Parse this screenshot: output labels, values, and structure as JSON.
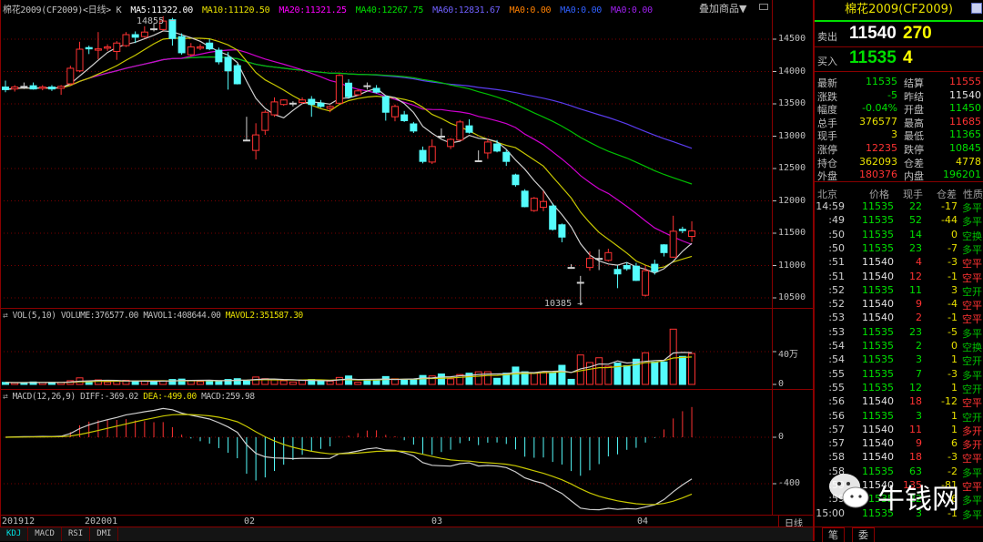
{
  "header": {
    "title": "棉花2009(CF2009)<日线> K",
    "ma_labels": [
      {
        "text": "MA5:11322.00",
        "color": "#ffffff"
      },
      {
        "text": "MA10:11120.50",
        "color": "#e8e000"
      },
      {
        "text": "MA20:11321.25",
        "color": "#ff00ff"
      },
      {
        "text": "MA40:12267.75",
        "color": "#00e000"
      },
      {
        "text": "MA60:12831.67",
        "color": "#7060ff"
      },
      {
        "text": "MA0:0.00",
        "color": "#ff8000"
      },
      {
        "text": "MA0:0.00",
        "color": "#3060ff"
      },
      {
        "text": "MA0:0.00",
        "color": "#a020f0"
      }
    ],
    "overlay_label": "叠加商品▼"
  },
  "volume_header": {
    "title": "VOL(5,10)",
    "volume": "VOLUME:376577.00",
    "mavol1": "MAVOL1:408644.00",
    "mavol2": "MAVOL2:351587.30"
  },
  "macd_header": {
    "title": "MACD(12,26,9)",
    "diff": "DIFF:-369.02",
    "dea": "DEA:-499.00",
    "macd": "MACD:259.98"
  },
  "chart_data": [
    {
      "type": "candlestick",
      "price_axis": {
        "ticks": [
          "14500",
          "14000",
          "13500",
          "13000",
          "12500",
          "12000",
          "11500",
          "11000",
          "10500"
        ],
        "range": [
          10500,
          14500
        ]
      },
      "volume_axis": {
        "ticks": [
          "40万",
          "0"
        ],
        "unit": "万"
      },
      "macd_axis": {
        "ticks": [
          "0",
          "-400"
        ]
      },
      "x_labels": [
        "201912",
        "202001",
        "02",
        "03",
        "04"
      ],
      "period_label": "日线",
      "annotations": {
        "high": "14855",
        "low": "10385"
      },
      "ma_periods": [
        5,
        10,
        20,
        40,
        60
      ],
      "colors": {
        "up": "#ff3232",
        "down": "#54fcfc",
        "ma5": "#d0d0d0",
        "ma10": "#c8c800",
        "ma20": "#d000d0",
        "ma40": "#00c000",
        "ma60": "#5a3cf0"
      },
      "ohlc": [
        [
          13760,
          13860,
          13680,
          13720
        ],
        [
          13730,
          13790,
          13690,
          13760
        ],
        [
          13770,
          13830,
          13730,
          13760
        ],
        [
          13780,
          13830,
          13720,
          13730
        ],
        [
          13740,
          13790,
          13710,
          13760
        ],
        [
          13760,
          13790,
          13700,
          13730
        ],
        [
          13740,
          13790,
          13640,
          13770
        ],
        [
          13810,
          14090,
          13790,
          14050
        ],
        [
          14010,
          14460,
          13990,
          14345
        ],
        [
          14370,
          14400,
          14270,
          14350
        ],
        [
          14330,
          14610,
          14190,
          14350
        ],
        [
          14360,
          14420,
          14320,
          14380
        ],
        [
          14310,
          14470,
          14180,
          14440
        ],
        [
          14400,
          14610,
          14380,
          14570
        ],
        [
          14570,
          14620,
          14440,
          14530
        ],
        [
          14540,
          14700,
          14520,
          14610
        ],
        [
          14660,
          14740,
          14620,
          14650
        ],
        [
          14650,
          14855,
          14630,
          14780
        ],
        [
          14800,
          14830,
          14400,
          14510
        ],
        [
          14540,
          14590,
          14260,
          14290
        ],
        [
          14260,
          14440,
          14230,
          14380
        ],
        [
          14360,
          14420,
          14330,
          14380
        ],
        [
          14440,
          14500,
          14330,
          14350
        ],
        [
          14330,
          14370,
          14110,
          14150
        ],
        [
          14220,
          14300,
          13720,
          14010
        ],
        [
          14090,
          14120,
          13800,
          13810
        ],
        [
          12940,
          13300,
          12930,
          12940
        ],
        [
          12780,
          13200,
          12640,
          13020
        ],
        [
          13090,
          13400,
          13020,
          13370
        ],
        [
          13330,
          13600,
          13300,
          13530
        ],
        [
          13490,
          13570,
          13470,
          13560
        ],
        [
          13500,
          13540,
          13460,
          13510
        ],
        [
          13520,
          13600,
          13500,
          13560
        ],
        [
          13570,
          13620,
          13300,
          13490
        ],
        [
          13510,
          13560,
          13440,
          13460
        ],
        [
          13430,
          13480,
          13370,
          13460
        ],
        [
          13510,
          13960,
          13500,
          13940
        ],
        [
          13820,
          13880,
          13580,
          13610
        ],
        [
          13640,
          13730,
          13620,
          13700
        ],
        [
          13780,
          13830,
          13720,
          13770
        ],
        [
          13740,
          13790,
          13660,
          13680
        ],
        [
          13610,
          13630,
          13240,
          13370
        ],
        [
          13300,
          13490,
          13230,
          13460
        ],
        [
          13330,
          13390,
          13220,
          13240
        ],
        [
          13190,
          13220,
          13050,
          13080
        ],
        [
          12780,
          12840,
          12580,
          12610
        ],
        [
          12600,
          12950,
          12570,
          12840
        ],
        [
          13000,
          13120,
          12970,
          12990
        ],
        [
          12840,
          12970,
          12800,
          12950
        ],
        [
          12940,
          13250,
          12930,
          13220
        ],
        [
          13160,
          13260,
          13040,
          13060
        ],
        [
          12610,
          12780,
          12600,
          12620
        ],
        [
          12740,
          12960,
          12650,
          12910
        ],
        [
          12880,
          12940,
          12750,
          12770
        ],
        [
          12750,
          12790,
          12540,
          12610
        ],
        [
          12400,
          12420,
          12220,
          12250
        ],
        [
          12150,
          12180,
          11900,
          11910
        ],
        [
          11850,
          12060,
          11830,
          12040
        ],
        [
          11900,
          12150,
          11840,
          11990
        ],
        [
          11920,
          11960,
          11540,
          11560
        ],
        [
          11630,
          11650,
          11360,
          11440
        ],
        [
          10970,
          11020,
          10950,
          10960
        ],
        [
          10730,
          10840,
          10385,
          10740
        ],
        [
          10970,
          11220,
          10920,
          11110
        ],
        [
          11100,
          11250,
          10930,
          11110
        ],
        [
          11080,
          11260,
          11060,
          11200
        ],
        [
          10940,
          11000,
          10650,
          10870
        ],
        [
          11000,
          11050,
          10920,
          10950
        ],
        [
          10990,
          11040,
          10760,
          10770
        ],
        [
          10540,
          11000,
          10520,
          10920
        ],
        [
          11020,
          11090,
          10860,
          10910
        ],
        [
          11320,
          11330,
          11140,
          11200
        ],
        [
          11130,
          11770,
          11120,
          11530
        ],
        [
          11560,
          11600,
          11500,
          11540
        ],
        [
          11450,
          11685,
          11365,
          11535
        ]
      ],
      "volume_thousands": [
        25,
        20,
        22,
        30,
        22,
        25,
        25,
        45,
        80,
        40,
        55,
        30,
        40,
        50,
        35,
        40,
        30,
        45,
        60,
        65,
        45,
        35,
        50,
        40,
        60,
        70,
        40,
        90,
        70,
        55,
        45,
        30,
        50,
        60,
        45,
        40,
        85,
        103,
        27,
        51,
        51,
        96,
        68,
        58,
        58,
        109,
        103,
        127,
        68,
        120,
        137,
        154,
        154,
        75,
        137,
        212,
        154,
        137,
        154,
        144,
        233,
        62,
        359,
        267,
        325,
        222,
        260,
        229,
        308,
        386,
        274,
        274,
        674,
        342,
        377
      ]
    }
  ],
  "tabs": [
    "KDJ",
    "MACD",
    "RSI",
    "DMI"
  ],
  "panel": {
    "title": "棉花2009(CF2009)",
    "sell": {
      "label": "卖出",
      "price": "11540",
      "qty": "270"
    },
    "buy": {
      "label": "买入",
      "price": "11535",
      "qty": "4"
    },
    "stats": [
      {
        "l1": "最新",
        "v1": "11535",
        "c1": "#00e000",
        "l2": "结算",
        "v2": "11555",
        "c2": "#ff3232"
      },
      {
        "l1": "涨跌",
        "v1": "-5",
        "c1": "#00e000",
        "l2": "昨结",
        "v2": "11540",
        "c2": "#e0e0e0"
      },
      {
        "l1": "幅度",
        "v1": "-0.04%",
        "c1": "#00e000",
        "l2": "开盘",
        "v2": "11450",
        "c2": "#00e000"
      },
      {
        "l1": "总手",
        "v1": "376577",
        "c1": "#e8e000",
        "l2": "最高",
        "v2": "11685",
        "c2": "#ff3232"
      },
      {
        "l1": "现手",
        "v1": "3",
        "c1": "#e8e000",
        "l2": "最低",
        "v2": "11365",
        "c2": "#00e000"
      },
      {
        "l1": "涨停",
        "v1": "12235",
        "c1": "#ff3232",
        "l2": "跌停",
        "v2": "10845",
        "c2": "#00e000"
      },
      {
        "l1": "持仓",
        "v1": "362093",
        "c1": "#e8e000",
        "l2": "仓差",
        "v2": "4778",
        "c2": "#e8e000"
      },
      {
        "l1": "外盘",
        "v1": "180376",
        "c1": "#ff3232",
        "l2": "内盘",
        "v2": "196201",
        "c2": "#00e000"
      }
    ],
    "ticks_header": [
      "北京",
      "价格",
      "现手",
      "仓差",
      "性质"
    ],
    "ticks": [
      {
        "t": "14:59",
        "p": "11535",
        "v": "22",
        "d": "-17",
        "n": "多平",
        "side": "down"
      },
      {
        "t": ":49",
        "p": "11535",
        "v": "52",
        "d": "-44",
        "n": "多平",
        "side": "down"
      },
      {
        "t": ":50",
        "p": "11535",
        "v": "14",
        "d": "0",
        "n": "空换",
        "side": "down"
      },
      {
        "t": ":50",
        "p": "11535",
        "v": "23",
        "d": "-7",
        "n": "多平",
        "side": "down"
      },
      {
        "t": ":51",
        "p": "11540",
        "v": "4",
        "d": "-3",
        "n": "空平",
        "side": "up"
      },
      {
        "t": ":51",
        "p": "11540",
        "v": "12",
        "d": "-1",
        "n": "空平",
        "side": "up"
      },
      {
        "t": ":52",
        "p": "11535",
        "v": "11",
        "d": "3",
        "n": "空开",
        "side": "down"
      },
      {
        "t": ":52",
        "p": "11540",
        "v": "9",
        "d": "-4",
        "n": "空平",
        "side": "up"
      },
      {
        "t": ":53",
        "p": "11540",
        "v": "2",
        "d": "-1",
        "n": "空平",
        "side": "up"
      },
      {
        "t": ":53",
        "p": "11535",
        "v": "23",
        "d": "-5",
        "n": "多平",
        "side": "down"
      },
      {
        "t": ":54",
        "p": "11535",
        "v": "2",
        "d": "0",
        "n": "空换",
        "side": "down"
      },
      {
        "t": ":54",
        "p": "11535",
        "v": "3",
        "d": "1",
        "n": "空开",
        "side": "down"
      },
      {
        "t": ":55",
        "p": "11535",
        "v": "7",
        "d": "-3",
        "n": "多平",
        "side": "down"
      },
      {
        "t": ":55",
        "p": "11535",
        "v": "12",
        "d": "1",
        "n": "空开",
        "side": "down"
      },
      {
        "t": ":56",
        "p": "11540",
        "v": "18",
        "d": "-12",
        "n": "空平",
        "side": "up"
      },
      {
        "t": ":56",
        "p": "11535",
        "v": "3",
        "d": "1",
        "n": "空开",
        "side": "down"
      },
      {
        "t": ":57",
        "p": "11540",
        "v": "11",
        "d": "1",
        "n": "多开",
        "side": "up"
      },
      {
        "t": ":57",
        "p": "11540",
        "v": "9",
        "d": "6",
        "n": "多开",
        "side": "up"
      },
      {
        "t": ":58",
        "p": "11540",
        "v": "18",
        "d": "-3",
        "n": "空平",
        "side": "up"
      },
      {
        "t": ":58",
        "p": "11535",
        "v": "63",
        "d": "-2",
        "n": "多平",
        "side": "down"
      },
      {
        "t": ":59",
        "p": "11540",
        "v": "135",
        "d": "-81",
        "n": "空平",
        "side": "up"
      },
      {
        "t": ":59",
        "p": "11535",
        "v": "22",
        "d": "6",
        "n": "多平",
        "side": "down"
      },
      {
        "t": "15:00",
        "p": "11535",
        "v": "3",
        "d": "-1",
        "n": "多平",
        "side": "down"
      }
    ],
    "tabs": [
      "笔",
      "委"
    ],
    "watermark": "牛钱网"
  }
}
